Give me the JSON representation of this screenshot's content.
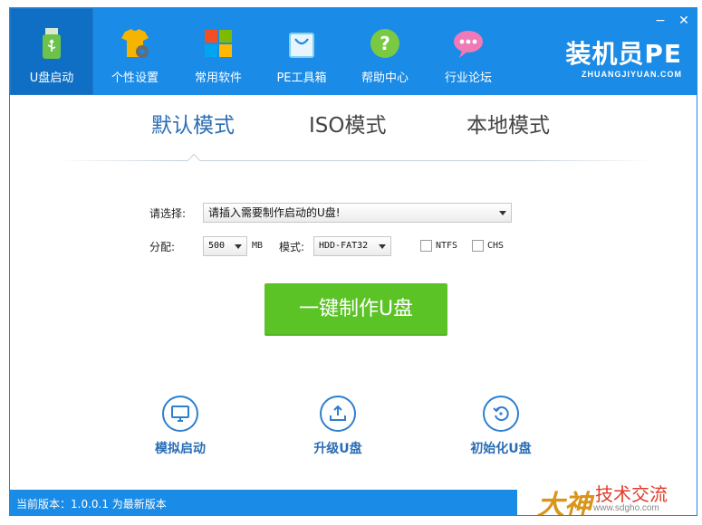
{
  "window": {
    "close_glyph": "✕",
    "minimize_glyph": "−"
  },
  "nav": {
    "items": [
      {
        "label": "U盘启动",
        "icon": "usb-drive-icon"
      },
      {
        "label": "个性设置",
        "icon": "tshirt-gear-icon"
      },
      {
        "label": "常用软件",
        "icon": "windows-tiles-icon"
      },
      {
        "label": "PE工具箱",
        "icon": "toolbox-bag-icon"
      },
      {
        "label": "帮助中心",
        "icon": "help-question-icon"
      },
      {
        "label": "行业论坛",
        "icon": "chat-bubble-icon"
      }
    ],
    "active_index": 0
  },
  "brand": {
    "title": "装机员PE",
    "subtitle": "ZHUANGJIYUAN.COM"
  },
  "modes": {
    "items": [
      "默认模式",
      "ISO模式",
      "本地模式"
    ],
    "active_index": 0
  },
  "form": {
    "select_label": "请选择:",
    "select_value": "请插入需要制作启动的U盘!",
    "partition_label": "分配:",
    "partition_value": "500",
    "partition_unit": "MB",
    "mode_label": "模式:",
    "mode_value": "HDD-FAT32",
    "ntfs_label": "NTFS",
    "ntfs_checked": false,
    "chs_label": "CHS",
    "chs_checked": false
  },
  "make_button": {
    "label": "一键制作U盘"
  },
  "actions": [
    {
      "label": "模拟启动",
      "icon": "monitor-icon"
    },
    {
      "label": "升级U盘",
      "icon": "upload-tray-icon"
    },
    {
      "label": "初始化U盘",
      "icon": "restore-icon"
    }
  ],
  "status": {
    "text": "当前版本：1.0.0.1 为最新版本"
  },
  "watermark": {
    "logo": "大神",
    "title": "技术交流",
    "url": "www.sdgho.com"
  },
  "colors": {
    "header_blue": "#1a8be6",
    "active_nav": "#0f6fc4",
    "accent_text": "#2a6db5",
    "button_green": "#5cc327"
  }
}
